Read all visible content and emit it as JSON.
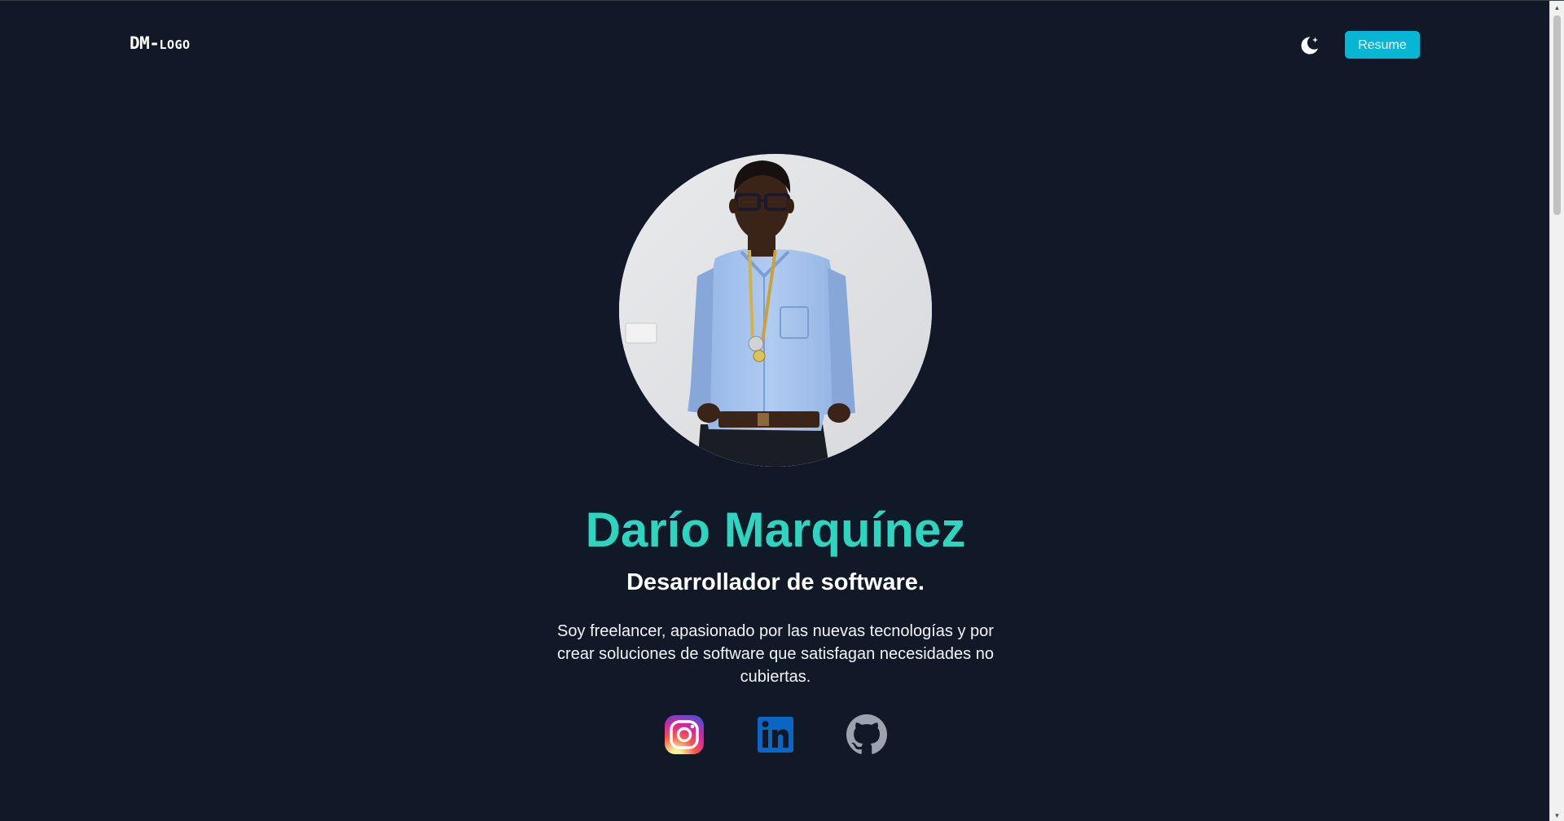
{
  "header": {
    "logo_main": "DM-",
    "logo_suffix": "LOGO",
    "theme_toggle_icon": "moon-icon",
    "resume_label": "Resume"
  },
  "profile": {
    "name": "Darío Marquínez",
    "role": "Desarrollador de software.",
    "bio": "Soy freelancer, apasionado por las nuevas tecnologías y por crear soluciones de software que satisfagan necesidades no cubiertas."
  },
  "socials": [
    {
      "icon": "instagram-icon"
    },
    {
      "icon": "linkedin-icon"
    },
    {
      "icon": "github-icon"
    }
  ],
  "colors": {
    "background": "#111827",
    "accent_name": "#2dd4bf",
    "button": "#06b6d4",
    "linkedin": "#0a66c2",
    "github": "#9ca3af"
  }
}
